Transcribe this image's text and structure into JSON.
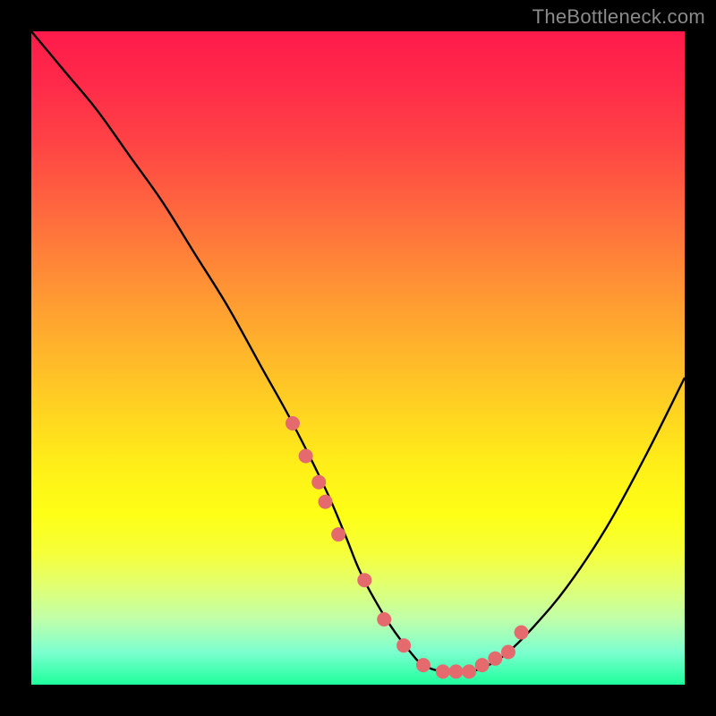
{
  "watermark": "TheBottleneck.com",
  "chart_data": {
    "type": "line",
    "title": "",
    "xlabel": "",
    "ylabel": "",
    "xlim": [
      0,
      100
    ],
    "ylim": [
      0,
      100
    ],
    "series": [
      {
        "name": "curve",
        "x": [
          0,
          5,
          10,
          15,
          20,
          25,
          30,
          35,
          40,
          45,
          48,
          50,
          52,
          55,
          58,
          60,
          63,
          67,
          70,
          73,
          77,
          82,
          88,
          94,
          100
        ],
        "y": [
          100,
          94,
          88,
          81,
          74,
          66,
          58,
          49,
          40,
          30,
          23,
          18,
          14,
          9,
          5,
          3,
          2,
          2,
          3,
          5,
          9,
          15,
          24,
          35,
          47
        ]
      }
    ],
    "markers": {
      "name": "highlight-dots",
      "x": [
        40,
        42,
        44,
        45,
        47,
        51,
        54,
        57,
        60,
        63,
        65,
        67,
        69,
        71,
        73,
        75
      ],
      "y": [
        40,
        35,
        31,
        28,
        23,
        16,
        10,
        6,
        3,
        2,
        2,
        2,
        3,
        4,
        5,
        8
      ]
    },
    "colors": {
      "curve": "#000000",
      "marker": "#e56a6e",
      "gradient_top": "#ff1b4b",
      "gradient_bottom": "#1eff9c"
    }
  }
}
